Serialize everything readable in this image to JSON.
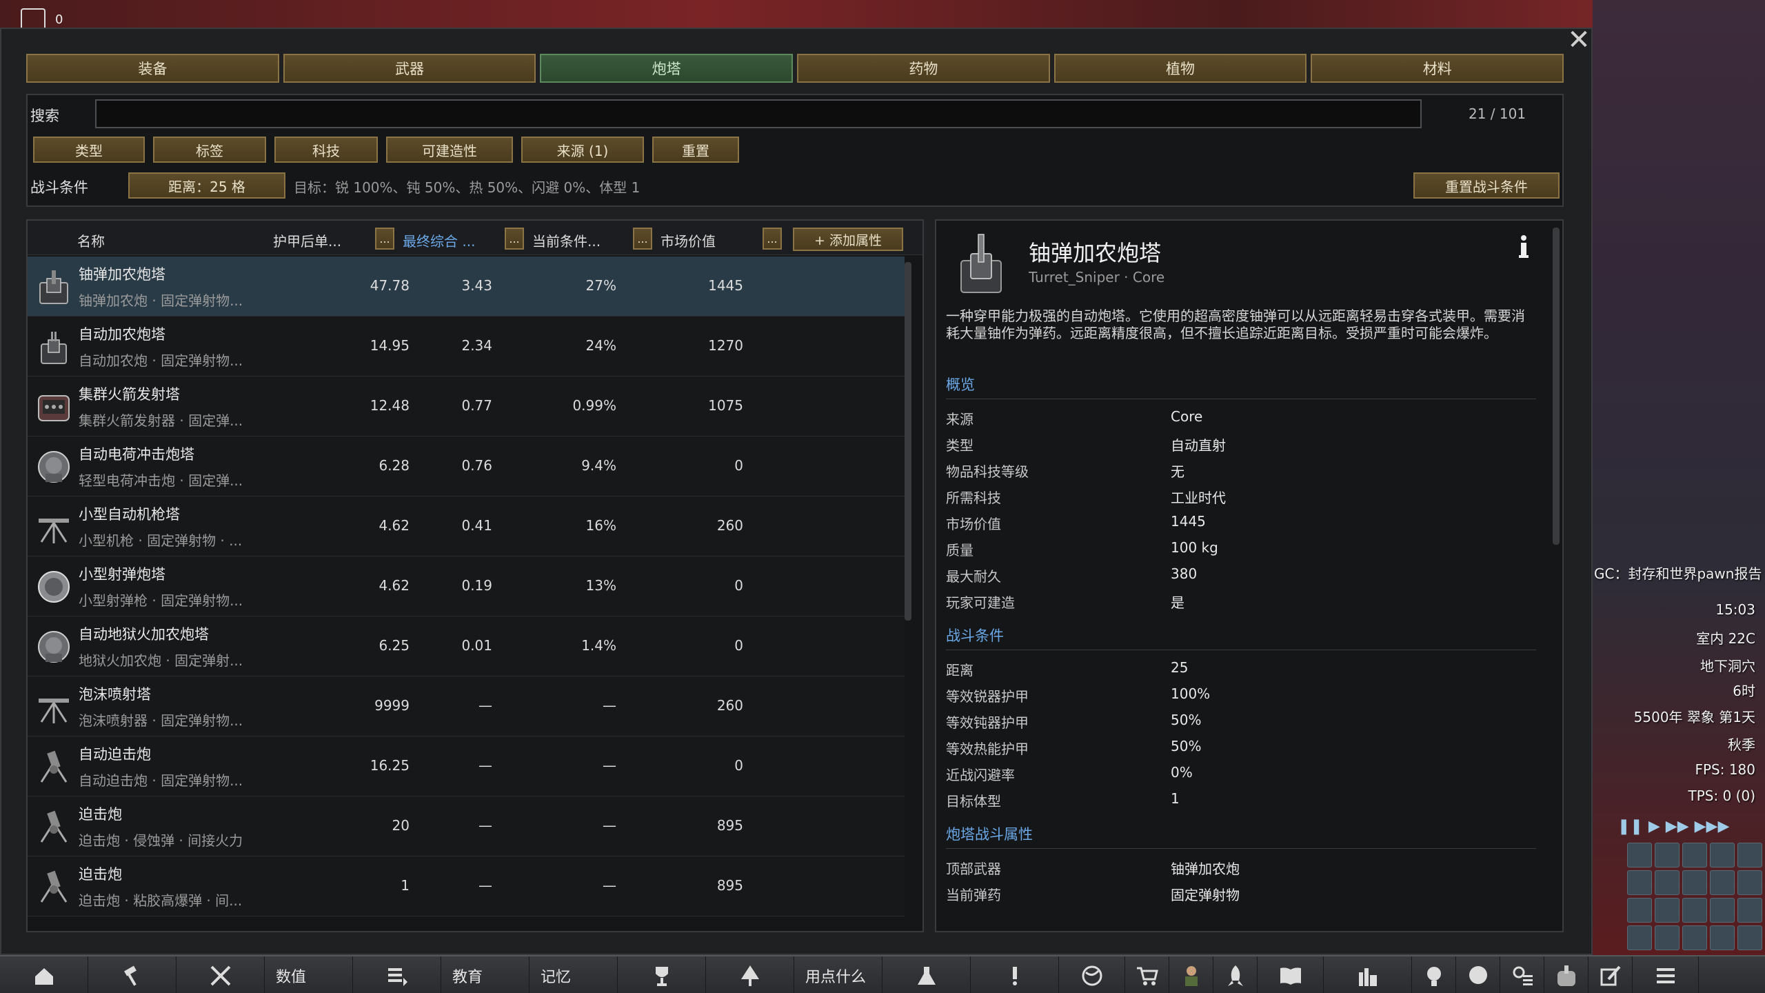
{
  "hud": {
    "top_counter": "0",
    "gc_text": "GC：封存和世界pawn报告",
    "time": "15:03",
    "temp": "室内 22C",
    "location": "地下洞穴",
    "hour": "6时",
    "date": "5500年 翠象 第1天",
    "season": "秋季",
    "fps": "FPS: 180",
    "tps": "TPS: 0 (0)"
  },
  "tabs": [
    {
      "label": "装备",
      "active": false
    },
    {
      "label": "武器",
      "active": false
    },
    {
      "label": "炮塔",
      "active": true
    },
    {
      "label": "药物",
      "active": false
    },
    {
      "label": "植物",
      "active": false
    },
    {
      "label": "材料",
      "active": false
    }
  ],
  "search": {
    "label": "搜索",
    "value": "",
    "count": "21 / 101"
  },
  "filters": [
    {
      "label": "类型"
    },
    {
      "label": "标签"
    },
    {
      "label": "科技"
    },
    {
      "label": "可建造性"
    },
    {
      "label": "来源 (1)"
    },
    {
      "label": "重置"
    }
  ],
  "combat": {
    "label": "战斗条件",
    "distance": "距离：25 格",
    "target": "目标：锐 100%、钝 50%、热 50%、闪避 0%、体型 1",
    "reset": "重置战斗条件"
  },
  "list": {
    "headers": {
      "name": "名称",
      "col1": "护甲后单...",
      "col2": "最终综合 ...",
      "col3": "当前条件...",
      "col4": "市场价值",
      "dots": "...",
      "add": "+ 添加属性"
    },
    "rows": [
      {
        "name": "铀弹加农炮塔",
        "sub": "铀弹加农炮 · 固定弹射物...",
        "v1": "47.78",
        "v2": "3.43",
        "v3": "27%",
        "v4": "1445",
        "icon": "sniper"
      },
      {
        "name": "自动加农炮塔",
        "sub": "自动加农炮 · 固定弹射物...",
        "v1": "14.95",
        "v2": "2.34",
        "v3": "24%",
        "v4": "1270",
        "icon": "autocannon"
      },
      {
        "name": "集群火箭发射塔",
        "sub": "集群火箭发射器 · 固定弹...",
        "v1": "12.48",
        "v2": "0.77",
        "v3": "0.99%",
        "v4": "1075",
        "icon": "rocket"
      },
      {
        "name": "自动电荷冲击炮塔",
        "sub": "轻型电荷冲击炮 · 固定弹...",
        "v1": "6.28",
        "v2": "0.76",
        "v3": "9.4%",
        "v4": "0",
        "icon": "round"
      },
      {
        "name": "小型自动机枪塔",
        "sub": "小型机枪 · 固定弹射物 · ...",
        "v1": "4.62",
        "v2": "0.41",
        "v3": "16%",
        "v4": "260",
        "icon": "tripod"
      },
      {
        "name": "小型射弹炮塔",
        "sub": "小型射弹枪 · 固定弹射物...",
        "v1": "4.62",
        "v2": "0.19",
        "v3": "13%",
        "v4": "0",
        "icon": "disc"
      },
      {
        "name": "自动地狱火加农炮塔",
        "sub": "地狱火加农炮 · 固定弹射...",
        "v1": "6.25",
        "v2": "0.01",
        "v3": "1.4%",
        "v4": "0",
        "icon": "round"
      },
      {
        "name": "泡沫喷射塔",
        "sub": "泡沫喷射器 · 固定弹射物...",
        "v1": "9999",
        "v2": "—",
        "v3": "—",
        "v4": "260",
        "icon": "tripod"
      },
      {
        "name": "自动迫击炮",
        "sub": "自动迫击炮 · 固定弹射物...",
        "v1": "16.25",
        "v2": "—",
        "v3": "—",
        "v4": "0",
        "icon": "mortar"
      },
      {
        "name": "迫击炮",
        "sub": "迫击炮 · 侵蚀弹 · 间接火力",
        "v1": "20",
        "v2": "—",
        "v3": "—",
        "v4": "895",
        "icon": "mortar"
      },
      {
        "name": "迫击炮",
        "sub": "迫击炮 · 粘胶高爆弹 · 间...",
        "v1": "1",
        "v2": "—",
        "v3": "—",
        "v4": "895",
        "icon": "mortar"
      }
    ]
  },
  "detail": {
    "title": "铀弹加农炮塔",
    "subtitle": "Turret_Sniper · Core",
    "description": "一种穿甲能力极强的自动炮塔。它使用的超高密度铀弹可以从远距离轻易击穿各式装甲。需要消耗大量铀作为弹药。远距离精度很高，但不擅长追踪近距离目标。受损严重时可能会爆炸。",
    "sections": [
      {
        "title": "概览",
        "rows": [
          {
            "k": "来源",
            "v": "Core"
          },
          {
            "k": "类型",
            "v": "自动直射"
          },
          {
            "k": "物品科技等级",
            "v": "无"
          },
          {
            "k": "所需科技",
            "v": "工业时代"
          },
          {
            "k": "市场价值",
            "v": "1445"
          },
          {
            "k": "质量",
            "v": "100 kg"
          },
          {
            "k": "最大耐久",
            "v": "380"
          },
          {
            "k": "玩家可建造",
            "v": "是"
          }
        ]
      },
      {
        "title": "战斗条件",
        "rows": [
          {
            "k": "距离",
            "v": "25"
          },
          {
            "k": "等效锐器护甲",
            "v": "100%"
          },
          {
            "k": "等效钝器护甲",
            "v": "50%"
          },
          {
            "k": "等效热能护甲",
            "v": "50%"
          },
          {
            "k": "近战闪避率",
            "v": "0%"
          },
          {
            "k": "目标体型",
            "v": "1"
          }
        ]
      },
      {
        "title": "炮塔战斗属性",
        "rows": [
          {
            "k": "顶部武器",
            "v": "铀弹加农炮"
          },
          {
            "k": "当前弹药",
            "v": "固定弹射物"
          }
        ]
      }
    ]
  },
  "bottom_bar": [
    {
      "type": "icon",
      "icon": "home-icon"
    },
    {
      "type": "icon",
      "icon": "hammer-icon"
    },
    {
      "type": "icon",
      "icon": "crossed-swords-icon"
    },
    {
      "type": "text",
      "label": "数值"
    },
    {
      "type": "icon",
      "icon": "list-arrow-icon"
    },
    {
      "type": "text",
      "label": "教育"
    },
    {
      "type": "text",
      "label": "记忆"
    },
    {
      "type": "icon",
      "icon": "trophy-icon"
    },
    {
      "type": "icon",
      "icon": "tree-icon"
    },
    {
      "type": "text",
      "label": "用点什么"
    },
    {
      "type": "icon",
      "icon": "flask-icon"
    },
    {
      "type": "icon",
      "icon": "exclamation-icon"
    },
    {
      "type": "icon",
      "icon": "globe-icon"
    },
    {
      "type": "icon",
      "icon": "cart-icon"
    },
    {
      "type": "icon",
      "icon": "pawn-icon"
    },
    {
      "type": "icon",
      "icon": "rocket-icon"
    },
    {
      "type": "icon",
      "icon": "book-icon"
    },
    {
      "type": "icon",
      "icon": "factory-icon"
    },
    {
      "type": "icon",
      "icon": "bulb-icon"
    },
    {
      "type": "icon",
      "icon": "head-icon"
    },
    {
      "type": "icon",
      "icon": "gear-list-icon"
    },
    {
      "type": "icon",
      "icon": "turret-icon"
    },
    {
      "type": "icon",
      "icon": "edit-icon"
    },
    {
      "type": "icon",
      "icon": "menu-icon"
    }
  ]
}
